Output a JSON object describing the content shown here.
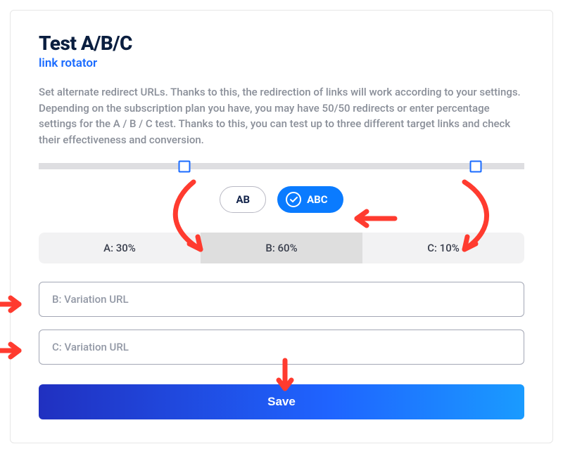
{
  "title": "Test A/B/C",
  "subtitle": "link rotator",
  "description": "Set alternate redirect URLs. Thanks to this, the redirection of links will work according to your settings. Depending on the subscription plan you have, you may have 50/50 redirects or enter percentage settings for the A / B / C test. Thanks to this, you can test up to three different target links and check their effectiveness and conversion.",
  "mode": {
    "ab_label": "AB",
    "abc_label": "ABC"
  },
  "slider": {
    "handle1_pct": 30,
    "handle2_pct": 90
  },
  "distribution": {
    "a_label": "A: 30%",
    "b_label": "B: 60%",
    "c_label": "C: 10%"
  },
  "inputs": {
    "b_placeholder": "B: Variation URL",
    "c_placeholder": "C: Variation URL"
  },
  "save_label": "Save",
  "colors": {
    "accent": "#1a6bff",
    "arrow": "#ff3b2f"
  }
}
